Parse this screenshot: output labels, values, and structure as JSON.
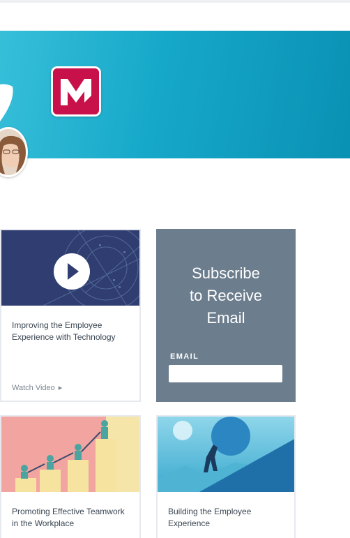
{
  "brand": {
    "logo_letter": "M",
    "accent": "#c8114a",
    "banner_color": "#16a8c9"
  },
  "cards": [
    {
      "title": "Improving the Employee Experience with Technology",
      "link": "Watch Video",
      "media": "play-icon"
    },
    {
      "title": "Promoting Effective Teamwork in the Workplace"
    },
    {
      "title": "Building the Employee Experience"
    }
  ],
  "subscribe": {
    "heading": "Subscribe\nto Receive\nEmail",
    "email_label": "EMAIL",
    "email_placeholder": "",
    "background": "#6c7d8e"
  }
}
